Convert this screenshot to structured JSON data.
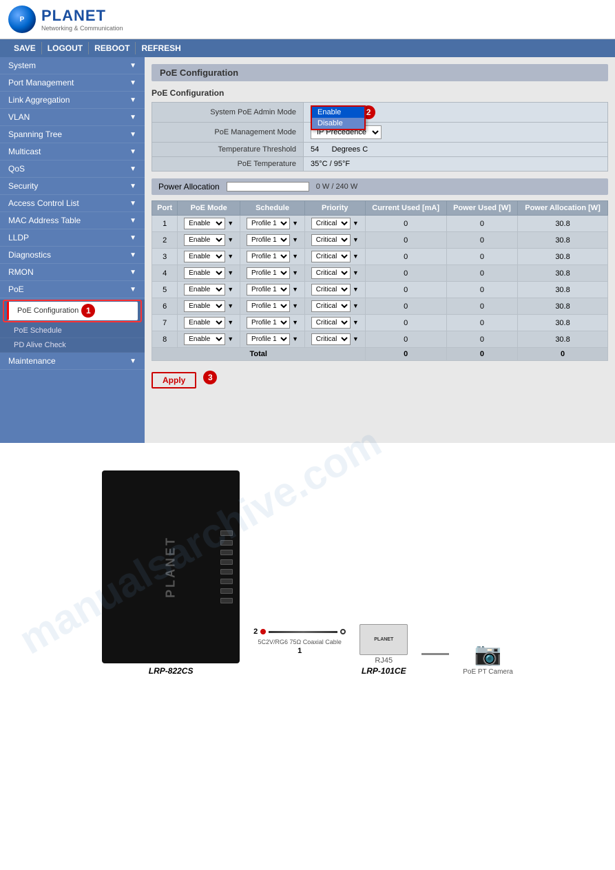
{
  "header": {
    "logo_text": "PLANET",
    "logo_sub": "Networking & Communication"
  },
  "toolbar": {
    "items": [
      "SAVE",
      "LOGOUT",
      "REBOOT",
      "REFRESH"
    ]
  },
  "sidebar": {
    "items": [
      {
        "label": "System",
        "arrow": "▼",
        "active": false
      },
      {
        "label": "Port Management",
        "arrow": "▼",
        "active": false
      },
      {
        "label": "Link Aggregation",
        "arrow": "▼",
        "active": false
      },
      {
        "label": "VLAN",
        "arrow": "▼",
        "active": false
      },
      {
        "label": "Spanning Tree",
        "arrow": "▼",
        "active": false
      },
      {
        "label": "Multicast",
        "arrow": "▼",
        "active": false
      },
      {
        "label": "QoS",
        "arrow": "▼",
        "active": false
      },
      {
        "label": "Security",
        "arrow": "▼",
        "active": false
      },
      {
        "label": "Access Control List",
        "arrow": "▼",
        "active": false
      },
      {
        "label": "MAC Address Table",
        "arrow": "▼",
        "active": false
      },
      {
        "label": "LLDP",
        "arrow": "▼",
        "active": false
      },
      {
        "label": "Diagnostics",
        "arrow": "▼",
        "active": false
      },
      {
        "label": "RMON",
        "arrow": "▼",
        "active": false
      },
      {
        "label": "PoE",
        "arrow": "▼",
        "active": true
      }
    ],
    "poe_sub": [
      {
        "label": "PoE Configuration",
        "active": true
      },
      {
        "label": "PoE Schedule",
        "active": false
      },
      {
        "label": "PD Alive Check",
        "active": false
      }
    ],
    "maintenance": {
      "label": "Maintenance",
      "arrow": "▼"
    }
  },
  "page_title": "PoE Configuration",
  "poe_config": {
    "section_label": "PoE Configuration",
    "rows": [
      {
        "label": "System PoE Admin Mode",
        "value": "Disable"
      },
      {
        "label": "PoE Management Mode",
        "value": ""
      },
      {
        "label": "Temperature Threshold",
        "value": "54        Degrees C"
      },
      {
        "label": "PoE Temperature",
        "value": "35°C / 95°F"
      }
    ],
    "dropdown_options": [
      "Disable",
      "Enable",
      "Disable"
    ],
    "dropdown_visible_option1": "Disable",
    "dropdown_popup_items": [
      {
        "label": "Enable",
        "state": "selected"
      },
      {
        "label": "Disable",
        "state": "highlighted"
      }
    ]
  },
  "power_allocation": {
    "label": "Power Allocation",
    "value": "0 W / 240 W"
  },
  "port_table": {
    "headers": [
      "Port",
      "PoE Mode",
      "Schedule",
      "Priority",
      "Current Used [mA]",
      "Power Used [W]",
      "Power Allocation [W]"
    ],
    "rows": [
      {
        "port": 1,
        "mode": "Enable",
        "schedule": "Profile 1",
        "priority": "Critical",
        "current": 0,
        "power": 0,
        "allocation": 30.8
      },
      {
        "port": 2,
        "mode": "Enable",
        "schedule": "Profile 1",
        "priority": "Critical",
        "current": 0,
        "power": 0,
        "allocation": 30.8
      },
      {
        "port": 3,
        "mode": "Enable",
        "schedule": "Profile 1",
        "priority": "Critical",
        "current": 0,
        "power": 0,
        "allocation": 30.8
      },
      {
        "port": 4,
        "mode": "Enable",
        "schedule": "Profile 1",
        "priority": "Critical",
        "current": 0,
        "power": 0,
        "allocation": 30.8
      },
      {
        "port": 5,
        "mode": "Enable",
        "schedule": "Profile 1",
        "priority": "Critical",
        "current": 0,
        "power": 0,
        "allocation": 30.8
      },
      {
        "port": 6,
        "mode": "Enable",
        "schedule": "Profile 1",
        "priority": "Critical",
        "current": 0,
        "power": 0,
        "allocation": 30.8
      },
      {
        "port": 7,
        "mode": "Enable",
        "schedule": "Profile 1",
        "priority": "Critical",
        "current": 0,
        "power": 0,
        "allocation": 30.8
      },
      {
        "port": 8,
        "mode": "Enable",
        "schedule": "Profile 1",
        "priority": "Critical",
        "current": 0,
        "power": 0,
        "allocation": 30.8
      }
    ],
    "total_row": {
      "label": "Total",
      "current": 0,
      "power": 0,
      "allocation": 0
    }
  },
  "apply_button": "Apply",
  "step_badges": {
    "badge1": "1",
    "badge2": "2",
    "badge3": "3"
  },
  "bottom_diagram": {
    "device1_label": "LRP-822CS",
    "device2_label": "LRP-101CE",
    "cable_label": "5C2V/RG6 75Ω Coaxial Cable",
    "port_label": "RJ45",
    "camera_label": "PoE PT Camera",
    "arrow_label": "2",
    "port_num": "1"
  }
}
